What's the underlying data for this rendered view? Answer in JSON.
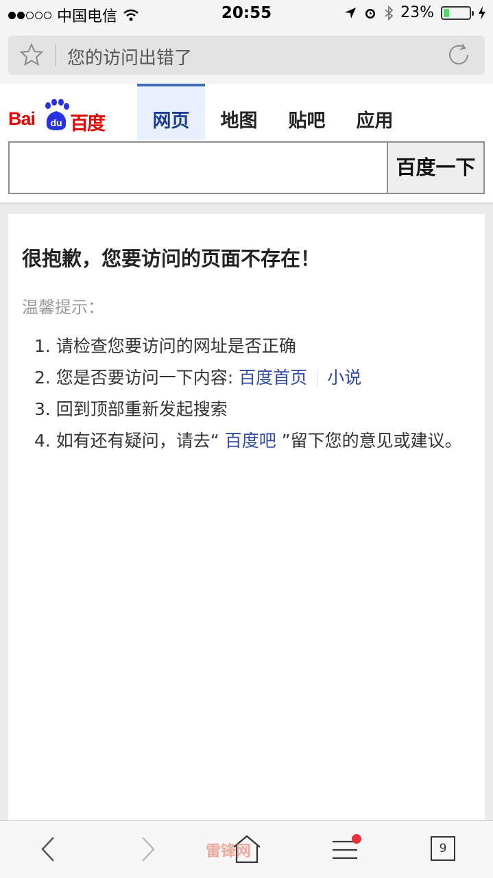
{
  "status": {
    "carrier": "中国电信",
    "time": "20:55",
    "battery": "23%",
    "battery_level": 0.23,
    "battery_color": "#4cd964"
  },
  "address": {
    "title": "您的访问出错了",
    "bookmark_icon": "star-icon",
    "reload_icon": "reload-icon"
  },
  "header": {
    "logo_latin": "Bai",
    "logo_du": "du",
    "logo_cn": "百度",
    "tabs": [
      {
        "label": "网页",
        "active": true
      },
      {
        "label": "地图",
        "active": false
      },
      {
        "label": "贴吧",
        "active": false
      },
      {
        "label": "应用",
        "active": false
      }
    ],
    "search_value": "",
    "search_button": "百度一下",
    "brand_color": "#e10601",
    "active_tab_color": "#3b6fb8"
  },
  "content": {
    "heading": "很抱歉，您要访问的页面不存在！",
    "tip": "温馨提示：",
    "items": {
      "i1": "1. 请检查您要访问的网址是否正确",
      "i2_prefix": "2. 您是否要访问一下内容: ",
      "i2_link1": "百度首页",
      "i2_link2": "小说",
      "i3": "3. 回到顶部重新发起搜索",
      "i4_prefix": "4. 如有还有疑问，请去“ ",
      "i4_link": "百度吧",
      "i4_suffix": " ”留下您的意见或建议。"
    },
    "link_color": "#2f4aa0"
  },
  "toolbar": {
    "watermark": "雷锋网",
    "tab_count": "9",
    "icons": [
      "back-icon",
      "forward-icon",
      "home-icon",
      "menu-icon",
      "tabs-icon"
    ]
  }
}
